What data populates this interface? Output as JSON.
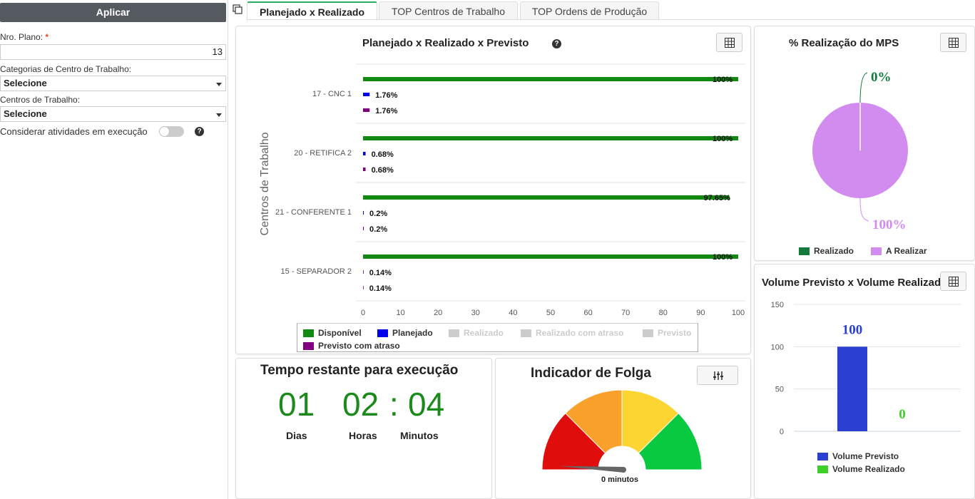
{
  "sidebar": {
    "apply_label": "Aplicar",
    "plan_label": "Nro. Plano:",
    "plan_required": "*",
    "plan_value": "13",
    "cat_label": "Categorias de Centro de Trabalho:",
    "cat_value": "Selecione",
    "centers_label": "Centros de Trabalho:",
    "centers_value": "Selecione",
    "consider_label": "Considerar atividades em execução",
    "consider_on": false
  },
  "tabs": [
    {
      "label": "Planejado x Realizado",
      "active": true
    },
    {
      "label": "TOP Centros de Trabalho",
      "active": false
    },
    {
      "label": "TOP Ordens de Produção",
      "active": false
    }
  ],
  "colors": {
    "disponivel": "#128a12",
    "planejado": "#0000ee",
    "previsto_atraso": "#800080",
    "disabled": "#cccccc",
    "realizado_mps": "#127a3a",
    "a_realizar": "#d28cf0",
    "volume_previsto": "#2b3fd1",
    "volume_realizado": "#3fcf2a"
  },
  "main_chart": {
    "title": "Planejado x Realizado x Previsto",
    "chart_data": {
      "type": "bar",
      "orientation": "horizontal",
      "title": "Planejado x Realizado x Previsto",
      "ylabel": "Centros de Trabalho",
      "xlim": [
        0,
        100
      ],
      "xticks": [
        "0",
        "10",
        "20",
        "30",
        "40",
        "50",
        "60",
        "70",
        "80",
        "90",
        "100"
      ],
      "categories": [
        "17 - CNC 1",
        "20 - RETIFICA 2",
        "21 - CONFERENTE 1",
        "15 - SEPARADOR 2"
      ],
      "series": [
        {
          "name": "Disponível",
          "values": [
            100,
            100,
            97.65,
            100
          ],
          "labels": [
            "100%",
            "100%",
            "97.65%",
            "100%"
          ]
        },
        {
          "name": "Planejado",
          "values": [
            1.76,
            0.68,
            0.2,
            0.14
          ],
          "labels": [
            "1.76%",
            "0.68%",
            "0.2%",
            "0.14%"
          ]
        },
        {
          "name": "Previsto com atraso",
          "values": [
            1.76,
            0.68,
            0.2,
            0.14
          ],
          "labels": [
            "1.76%",
            "0.68%",
            "0.2%",
            "0.14%"
          ]
        }
      ],
      "legend": [
        {
          "name": "Disponível",
          "active": true
        },
        {
          "name": "Planejado",
          "active": true
        },
        {
          "name": "Realizado",
          "active": false
        },
        {
          "name": "Realizado com atraso",
          "active": false
        },
        {
          "name": "Previsto",
          "active": false
        },
        {
          "name": "Previsto com atraso",
          "active": true
        }
      ],
      "legend_position": "bottom"
    }
  },
  "mps_chart": {
    "title": "% Realização do MPS",
    "chart_data": {
      "type": "pie",
      "title": "% Realização do MPS",
      "slices": [
        {
          "name": "Realizado",
          "value": 0,
          "label": "0%"
        },
        {
          "name": "A Realizar",
          "value": 100,
          "label": "100%"
        }
      ],
      "legend_position": "bottom"
    }
  },
  "volume_chart": {
    "title": "Volume Previsto x Volume Realizado",
    "chart_data": {
      "type": "bar",
      "title": "Volume Previsto x Volume Realizado",
      "ylim": [
        0,
        150
      ],
      "yticks": [
        "0",
        "50",
        "100",
        "150"
      ],
      "series": [
        {
          "name": "Volume Previsto",
          "value": 100,
          "label": "100"
        },
        {
          "name": "Volume Realizado",
          "value": 0,
          "label": "0"
        }
      ],
      "legend_position": "bottom"
    }
  },
  "remaining": {
    "title": "Tempo restante para execução",
    "days": "01",
    "hours": "02",
    "separator": ":",
    "minutes": "04",
    "days_label": "Dias",
    "hours_label": "Horas",
    "minutes_label": "Minutos"
  },
  "gauge": {
    "title": "Indicador de Folga",
    "value_label": "0 minutos",
    "value": 0,
    "bands": [
      "#e00d0d",
      "#f9a12a",
      "#fdd532",
      "#08c940"
    ]
  }
}
